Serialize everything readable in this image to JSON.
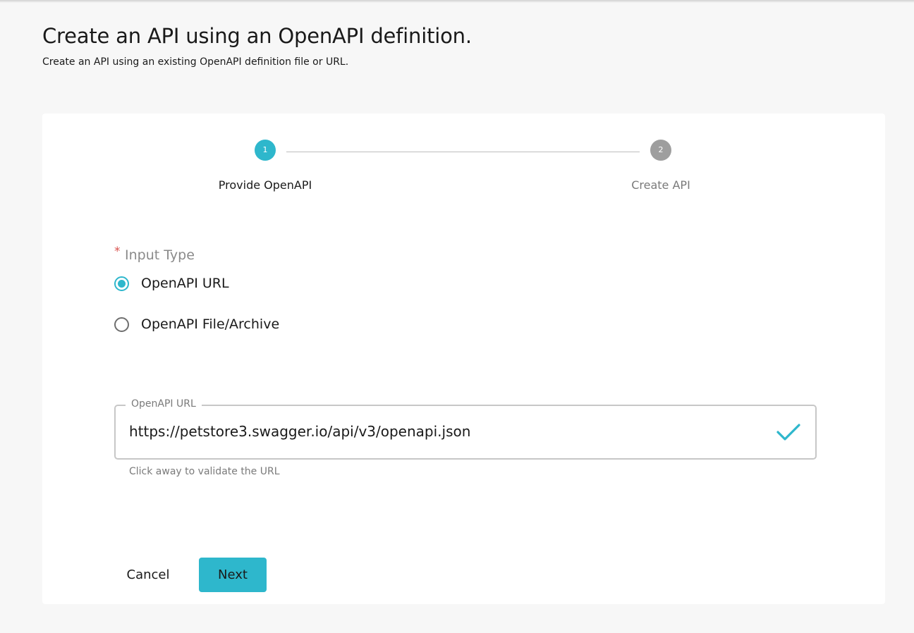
{
  "header": {
    "title": "Create an API using an OpenAPI definition.",
    "subtitle": "Create an API using an existing OpenAPI definition file or URL."
  },
  "stepper": {
    "steps": [
      {
        "number": "1",
        "label": "Provide OpenAPI",
        "state": "active"
      },
      {
        "number": "2",
        "label": "Create API",
        "state": "inactive"
      }
    ]
  },
  "input_type": {
    "required_mark": "*",
    "legend": "Input Type",
    "options": [
      {
        "label": "OpenAPI URL",
        "checked": true
      },
      {
        "label": "OpenAPI File/Archive",
        "checked": false
      }
    ]
  },
  "url_field": {
    "label": "OpenAPI URL",
    "value": "https://petstore3.swagger.io/api/v3/openapi.json",
    "helper": "Click away to validate the URL",
    "status_icon": "check-icon"
  },
  "actions": {
    "cancel_label": "Cancel",
    "next_label": "Next"
  },
  "colors": {
    "accent": "#2eb7cc",
    "inactive_step": "#9e9e9e",
    "required": "#d9534f",
    "background": "#f7f7f7"
  }
}
